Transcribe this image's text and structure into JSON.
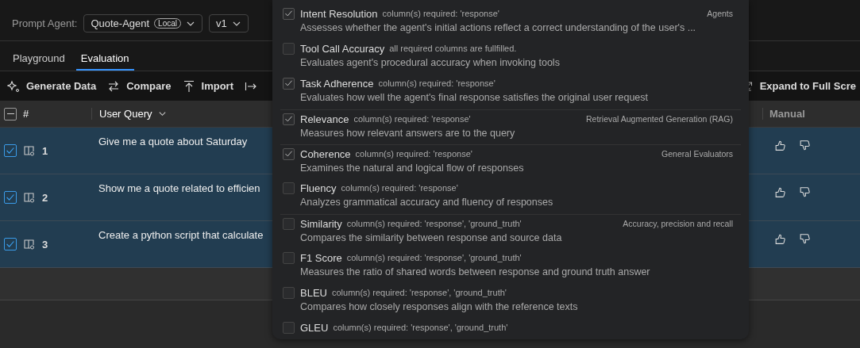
{
  "agent_bar": {
    "label": "Prompt Agent:",
    "agent": {
      "value": "Quote-Agent",
      "badge": "Local"
    },
    "version": {
      "value": "v1"
    }
  },
  "tabs": [
    {
      "label": "Playground",
      "selected": false
    },
    {
      "label": "Evaluation",
      "selected": true
    }
  ],
  "toolbar": [
    {
      "label": "Generate Data",
      "kind": "sparkle"
    },
    {
      "label": "Compare",
      "kind": "swap"
    },
    {
      "label": "Import",
      "kind": "import"
    },
    {
      "kind": "export"
    },
    {
      "label": "Expand to Full Scre",
      "kind": "expand"
    }
  ],
  "table": {
    "select_all": {
      "indeterminate": true
    },
    "columns": [
      "#",
      "User Query",
      "Manual"
    ],
    "rows": [
      {
        "checked": true,
        "number": "1",
        "query": "Give me a quote about Saturday"
      },
      {
        "checked": true,
        "number": "2",
        "query": "Show me a quote related to efficien"
      },
      {
        "checked": true,
        "number": "3",
        "query": "Create a python script that calculate"
      }
    ]
  },
  "evaluator_menu": {
    "items": [
      {
        "name": "Intent Resolution",
        "requirement": "column(s) required: 'response'",
        "group": "Agents",
        "description": "Assesses whether the agent's initial actions reflect a correct understanding of the user's ...",
        "checked": true
      },
      {
        "name": "Tool Call Accuracy",
        "requirement": "all required columns are fullfilled.",
        "description": "Evaluates agent's procedural accuracy when invoking tools",
        "checked": false
      },
      {
        "name": "Task Adherence",
        "requirement": "column(s) required: 'response'",
        "description": "Evaluates how well the agent's final response satisfies the original user request",
        "checked": true
      },
      {
        "name": "Relevance",
        "requirement": "column(s) required: 'response'",
        "group": "Retrieval Augmented Generation (RAG)",
        "description": "Measures how relevant answers are to the query",
        "checked": true
      },
      {
        "name": "Coherence",
        "requirement": "column(s) required: 'response'",
        "group": "General Evaluators",
        "description": "Examines the natural and logical flow of responses",
        "checked": true
      },
      {
        "name": "Fluency",
        "requirement": "column(s) required: 'response'",
        "description": "Analyzes grammatical accuracy and fluency of responses",
        "checked": false
      },
      {
        "name": "Similarity",
        "requirement": "column(s) required: 'response', 'ground_truth'",
        "group": "Accuracy, precision and recall",
        "description": "Compares the similarity between response and source data",
        "checked": false
      },
      {
        "name": "F1 Score",
        "requirement": "column(s) required: 'response', 'ground_truth'",
        "description": "Measures the ratio of shared words between response and ground truth answer",
        "checked": false
      },
      {
        "name": "BLEU",
        "requirement": "column(s) required: 'response', 'ground_truth'",
        "description": "Compares how closely responses align with the reference texts",
        "checked": false
      },
      {
        "name": "GLEU",
        "requirement": "column(s) required: 'response', 'ground_truth'",
        "checked": false
      }
    ]
  }
}
